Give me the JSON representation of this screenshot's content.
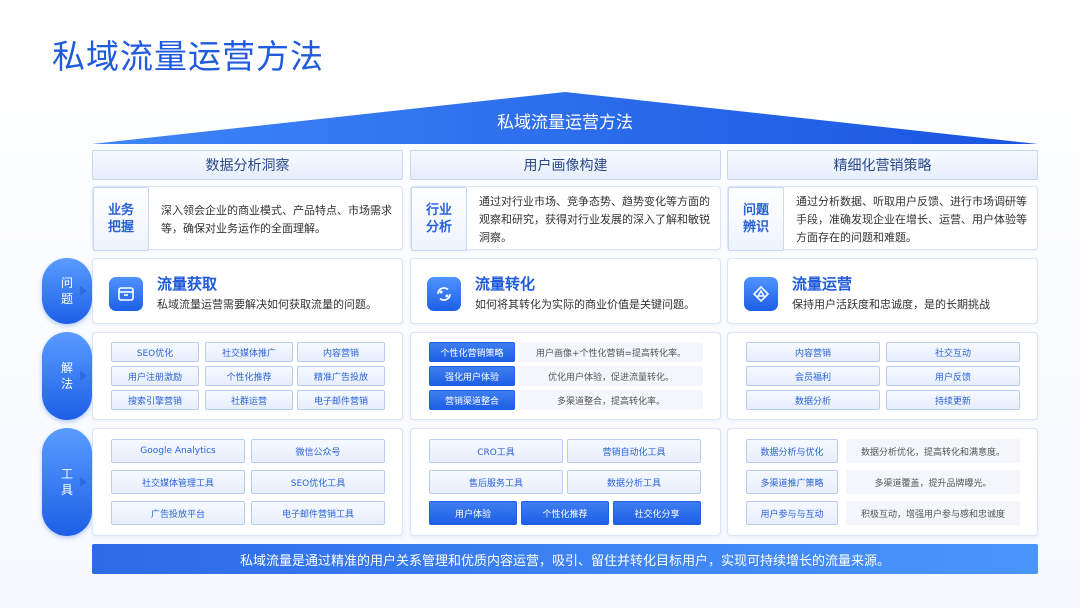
{
  "title": "私域流量运营方法",
  "roof_label": "私域流量运营方法",
  "columns": [
    {
      "header": "数据分析洞察",
      "tag": "业务\n把握",
      "desc": "深入领会企业的商业模式、产品特点、市场需求等，确保对业务运作的全面理解。"
    },
    {
      "header": "用户画像构建",
      "tag": "行业\n分析",
      "desc": "通过对行业市场、竞争态势、趋势变化等方面的观察和研究，获得对行业发展的深入了解和敏锐洞察。"
    },
    {
      "header": "精细化营销策略",
      "tag": "问题\n辨识",
      "desc": "通过分析数据、听取用户反馈、进行市场调研等手段，准确发现企业在增长、运营、用户体验等方面存在的问题和难题。"
    }
  ],
  "rows": {
    "problem": "问\n题",
    "solution": "解\n法",
    "tools": "工\n具"
  },
  "problems": [
    {
      "title": "流量获取",
      "text": "私域流量运营需要解决如何获取流量的问题。",
      "icon": "box-icon"
    },
    {
      "title": "流量转化",
      "text": "如何将其转化为实际的商业价值是关键问题。",
      "icon": "cycle-icon"
    },
    {
      "title": "流量运营",
      "text": "保持用户活跃度和忠诚度，是的长期挑战",
      "icon": "triangle-icon"
    }
  ],
  "solutions": {
    "col1": [
      "SEO优化",
      "社交媒体推广",
      "内容营销",
      "用户注册激励",
      "个性化推荐",
      "精准广告投放",
      "搜索引擎营销",
      "社群运营",
      "电子邮件营销"
    ],
    "col2": [
      {
        "chip": "个性化营销策略",
        "note": "用户画像+个性化营销=提高转化率。"
      },
      {
        "chip": "强化用户体验",
        "note": "优化用户体验，促进流量转化。"
      },
      {
        "chip": "营销渠道整合",
        "note": "多渠道整合，提高转化率。"
      }
    ],
    "col3": [
      "内容营销",
      "社交互动",
      "会员福利",
      "用户反馈",
      "数据分析",
      "持续更新"
    ]
  },
  "tools": {
    "col1": [
      "Google Analytics",
      "微信公众号",
      "社交媒体管理工具",
      "SEO优化工具",
      "广告投放平台",
      "电子邮件营销工具"
    ],
    "col2_top": [
      "CRO工具",
      "营销自动化工具",
      "售后服务工具",
      "数据分析工具"
    ],
    "col2_bottom": [
      "用户体验",
      "个性化推荐",
      "社交化分享"
    ],
    "col3": [
      {
        "chip": "数据分析与优化",
        "note": "数据分析优化，提高转化和满意度。"
      },
      {
        "chip": "多渠道推广策略",
        "note": "多渠道覆盖，提升品牌曝光。"
      },
      {
        "chip": "用户参与与互动",
        "note": "积极互动，增强用户参与感和忠诚度"
      }
    ]
  },
  "footer": "私域流量是通过精准的用户关系管理和优质内容运营，吸引、留住并转化目标用户，实现可持续增长的流量来源。",
  "colors": {
    "accent": "#1d5fe6",
    "accent_light": "#4f93ff"
  }
}
